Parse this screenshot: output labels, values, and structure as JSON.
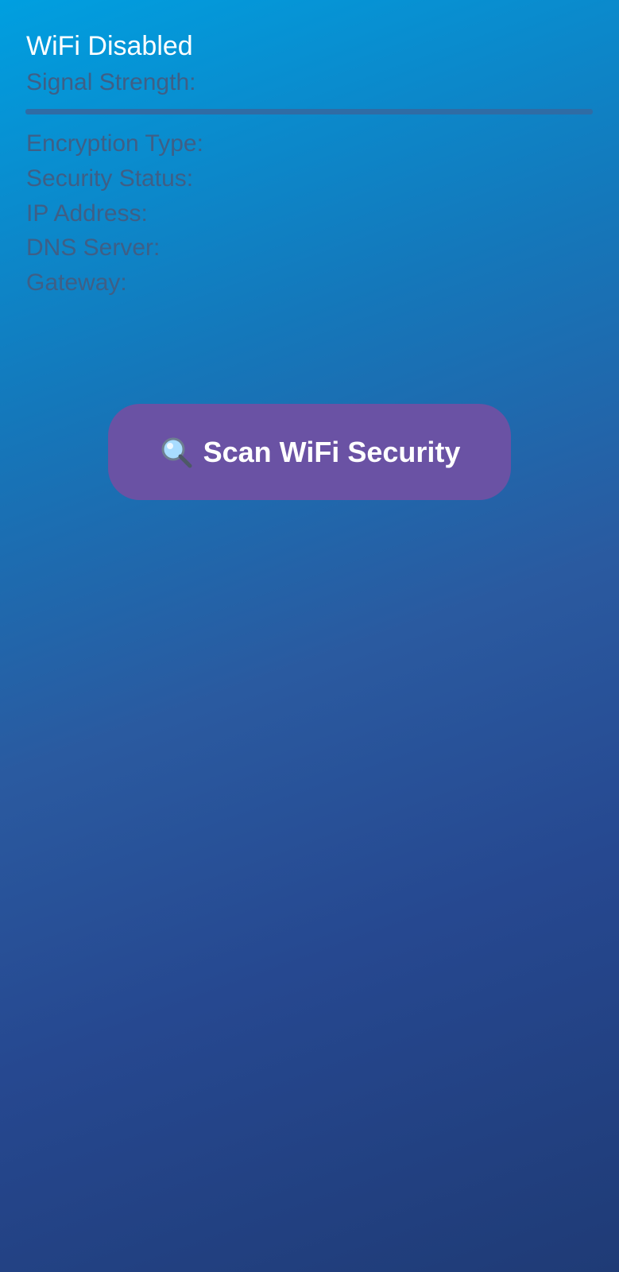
{
  "wifi": {
    "status": "WiFi Disabled",
    "signal_strength_label": "Signal Strength:"
  },
  "details": {
    "encryption_label": "Encryption Type:",
    "security_status_label": "Security Status:",
    "ip_address_label": "IP Address:",
    "dns_server_label": "DNS Server:",
    "gateway_label": "Gateway:"
  },
  "actions": {
    "scan_label": "Scan WiFi Security",
    "scan_icon": "magnifying-glass-icon"
  },
  "colors": {
    "background_top": "#009fe0",
    "background_bottom": "#1f3b76",
    "button_fill": "#6a52a4",
    "muted_text": "#3f5f86",
    "primary_text": "#ffffff"
  }
}
